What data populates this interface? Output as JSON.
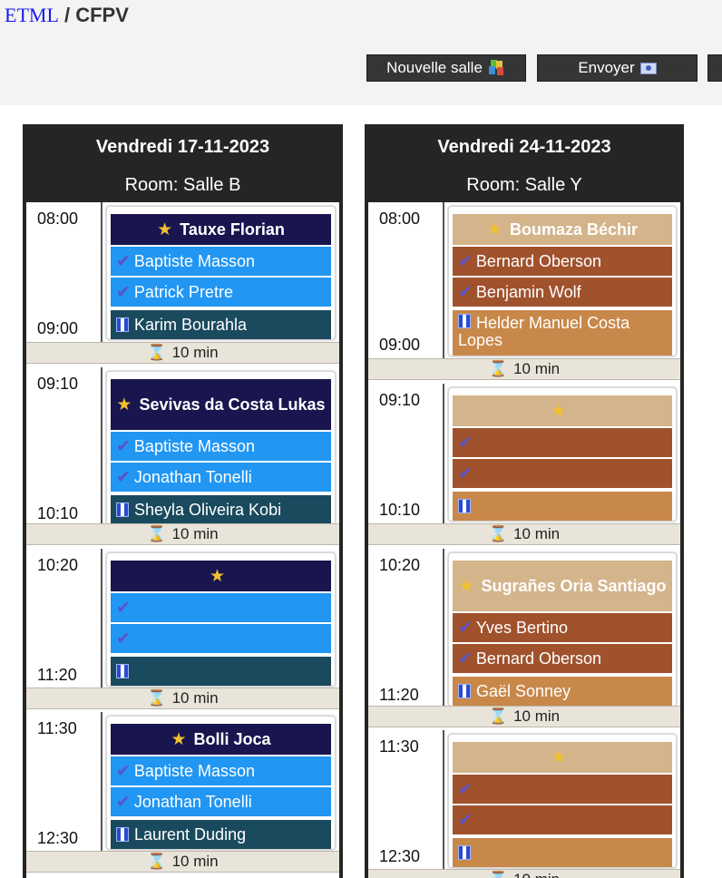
{
  "header": {
    "brand": "ETML",
    "separator": " / ",
    "section": "CFPV",
    "buttons": {
      "new_room": "Nouvelle salle",
      "send": "Envoyer"
    }
  },
  "days": [
    {
      "title": "Vendredi 17-11-2023",
      "room": "Room: Salle B",
      "theme": {
        "student": "#19154f",
        "expert": "#2196f3",
        "chef": "#1a4a5e"
      },
      "slots": [
        {
          "start": "08:00",
          "end": "09:00",
          "student": "Tauxe Florian",
          "expert1": "Baptiste Masson",
          "expert2": "Patrick Pretre",
          "chef": "Karim Bourahla"
        },
        {
          "start": "09:10",
          "end": "10:10",
          "student": "Sevivas da Costa Lukas",
          "expert1": "Baptiste Masson",
          "expert2": "Jonathan Tonelli",
          "chef": "Sheyla Oliveira Kobi"
        },
        {
          "start": "10:20",
          "end": "11:20",
          "student": "",
          "expert1": "",
          "expert2": "",
          "chef": ""
        },
        {
          "start": "11:30",
          "end": "12:30",
          "student": "Bolli Joca",
          "expert1": "Baptiste Masson",
          "expert2": "Jonathan Tonelli",
          "chef": "Laurent Duding"
        }
      ],
      "pause_label": "10 min"
    },
    {
      "title": "Vendredi 24-11-2023",
      "room": "Room: Salle Y",
      "theme": {
        "student": "#d4b48a",
        "expert": "#a0522d",
        "chef": "#c8884a"
      },
      "slots": [
        {
          "start": "08:00",
          "end": "09:00",
          "student": "Boumaza Béchir",
          "expert1": "Bernard Oberson",
          "expert2": "Benjamin Wolf",
          "chef": "Helder Manuel Costa Lopes"
        },
        {
          "start": "09:10",
          "end": "10:10",
          "student": "",
          "expert1": "",
          "expert2": "",
          "chef": ""
        },
        {
          "start": "10:20",
          "end": "11:20",
          "student": "Sugrañes Oria Santiago",
          "expert1": "Yves Bertino",
          "expert2": "Bernard Oberson",
          "chef": "Gaël Sonney"
        },
        {
          "start": "11:30",
          "end": "12:30",
          "student": "",
          "expert1": "",
          "expert2": "",
          "chef": ""
        }
      ],
      "pause_label": "10 min"
    }
  ],
  "icons": {
    "student": "star-icon",
    "expert": "checkmark-icon",
    "chef": "boss-icon",
    "pause": "hourglass-icon",
    "new_room": "rooms-icon",
    "send": "mail-icon"
  }
}
